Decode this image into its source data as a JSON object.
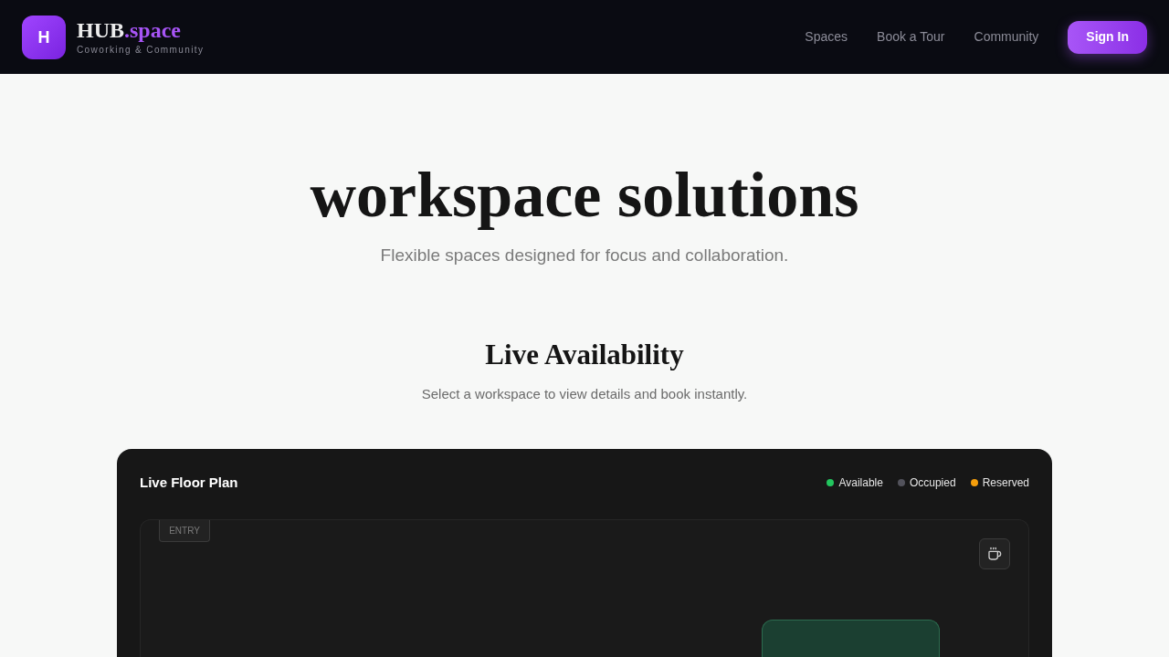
{
  "brand": {
    "mark": "H",
    "name": "HUB",
    "name_accent": ".space",
    "tagline": "Coworking & Community"
  },
  "nav": [
    "Spaces",
    "Book a Tour",
    "Community"
  ],
  "sign_in": "Sign In",
  "hero": {
    "title": "workspace solutions",
    "subtitle": "Flexible spaces designed for focus and collaboration."
  },
  "section": {
    "title": "Live Availability",
    "subtitle": "Select a workspace to view details and book instantly."
  },
  "floor_plan": {
    "title": "Live Floor Plan",
    "legend": [
      {
        "label": "Available",
        "color": "#22c55e"
      },
      {
        "label": "Occupied",
        "color": "#52525b"
      },
      {
        "label": "Reserved",
        "color": "#f59e0b"
      }
    ],
    "entry": "ENTRY",
    "spaces": [
      {
        "color": "#1b3f31"
      }
    ]
  }
}
